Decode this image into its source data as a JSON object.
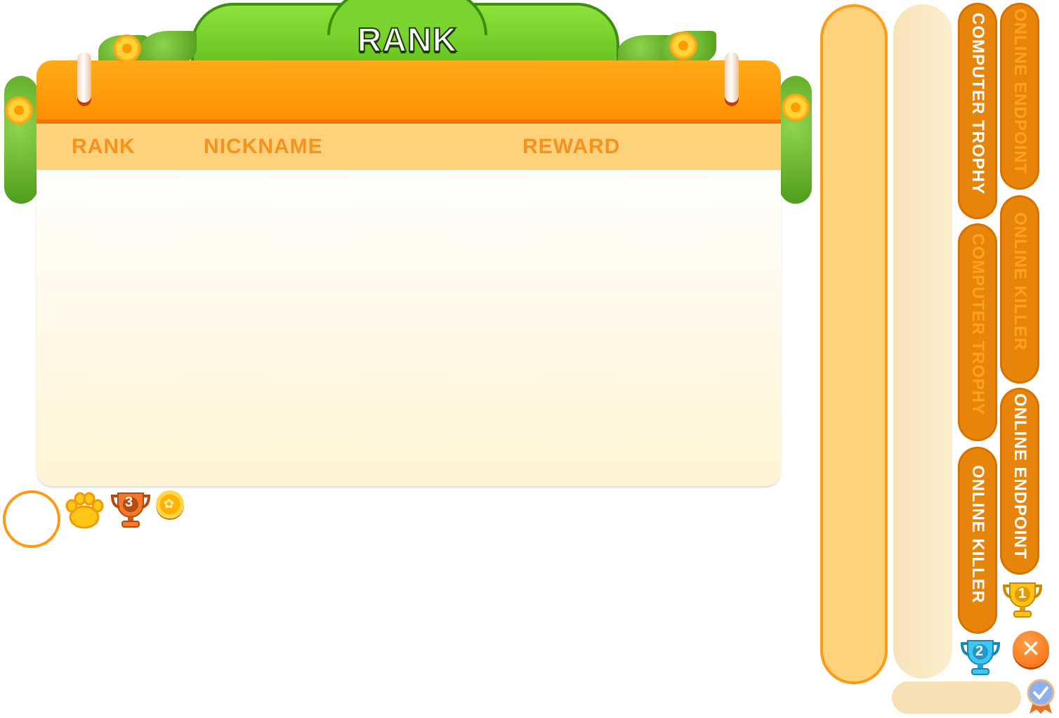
{
  "panel": {
    "title": "RANK",
    "columns": {
      "rank": "RANK",
      "nickname": "NICKNAME",
      "reward": "REWARD"
    }
  },
  "tabs": {
    "computer_trophy_on": "COMPUTER TROPHY",
    "computer_trophy_off": "COMPUTER TROPHY",
    "online_killer_on": "ONLINE KILLER",
    "online_killer_off": "ONLINE KILLER",
    "online_endpoint_on": "ONLINE ENDPOINT",
    "online_endpoint_off": "ONLINE ENDPOINT"
  },
  "trophies": {
    "gold": "1",
    "silver": "2",
    "bronze": "3"
  },
  "close_glyph": "✕",
  "icons": [
    "paw-icon",
    "trophy-icon",
    "coin-icon",
    "close-icon",
    "badge-icon"
  ],
  "colors": {
    "accent_orange": "#ff9a16",
    "header_orange": "#ff8f00",
    "column_bar": "#fdd27a",
    "title_green": "#79d42d"
  }
}
